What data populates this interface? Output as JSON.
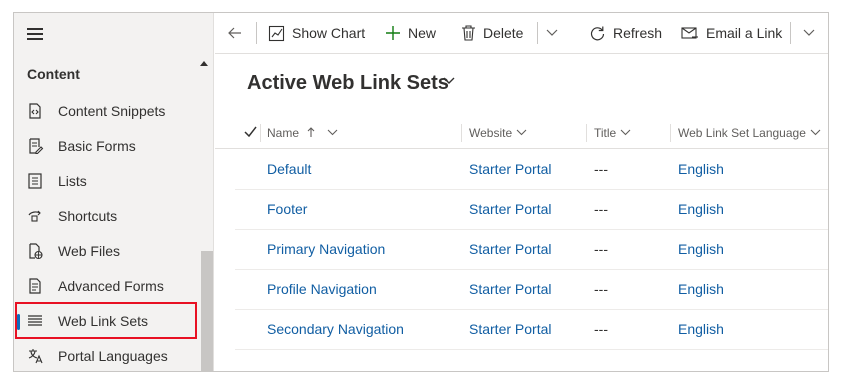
{
  "sidebar": {
    "group_title": "Content",
    "items": [
      {
        "label": "Content Snippets",
        "icon": "content-snippet-icon"
      },
      {
        "label": "Basic Forms",
        "icon": "form-icon"
      },
      {
        "label": "Lists",
        "icon": "list-icon"
      },
      {
        "label": "Shortcuts",
        "icon": "shortcut-icon"
      },
      {
        "label": "Web Files",
        "icon": "web-file-icon"
      },
      {
        "label": "Advanced Forms",
        "icon": "advanced-form-icon"
      },
      {
        "label": "Web Link Sets",
        "icon": "web-link-set-icon",
        "selected": true
      },
      {
        "label": "Portal Languages",
        "icon": "language-icon"
      }
    ]
  },
  "commands": {
    "back": "back-arrow-icon",
    "show_chart": "Show Chart",
    "new": "New",
    "delete": "Delete",
    "refresh": "Refresh",
    "email_link": "Email a Link"
  },
  "view": {
    "title": "Active Web Link Sets"
  },
  "grid": {
    "columns": [
      "Name",
      "Website",
      "Title",
      "Web Link Set Language"
    ],
    "sort": {
      "column": "Name",
      "direction": "ascending"
    },
    "rows": [
      {
        "name": "Default",
        "website": "Starter Portal",
        "title": "---",
        "language": "English"
      },
      {
        "name": "Footer",
        "website": "Starter Portal",
        "title": "---",
        "language": "English"
      },
      {
        "name": "Primary Navigation",
        "website": "Starter Portal",
        "title": "---",
        "language": "English"
      },
      {
        "name": "Profile Navigation",
        "website": "Starter Portal",
        "title": "---",
        "language": "English"
      },
      {
        "name": "Secondary Navigation",
        "website": "Starter Portal",
        "title": "---",
        "language": "English"
      }
    ]
  },
  "colors": {
    "accent": "#0f6cbd",
    "link": "#115ea3",
    "highlight": "#e81123",
    "new_icon": "#107c10"
  }
}
